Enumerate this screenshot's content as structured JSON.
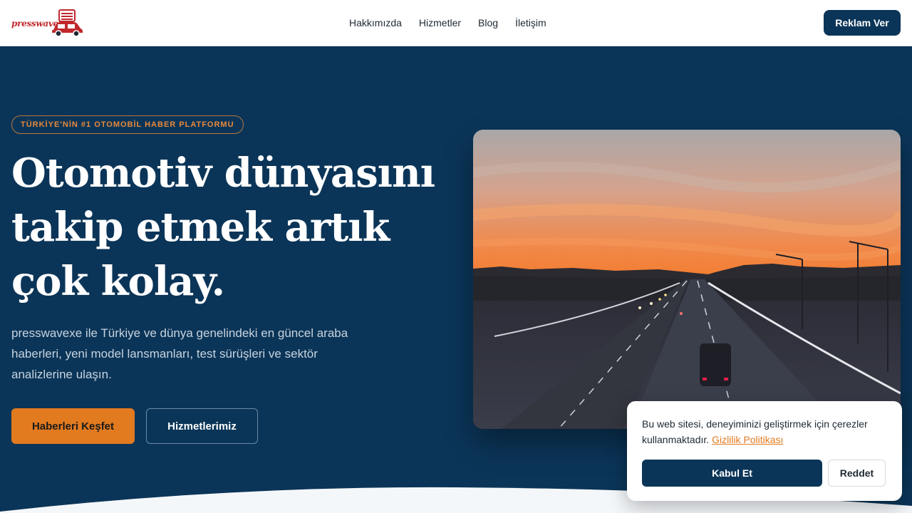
{
  "header": {
    "logo_text": "presswavexe",
    "nav": [
      "Hakkımızda",
      "Hizmetler",
      "Blog",
      "İletişim"
    ],
    "cta_label": "Reklam Ver"
  },
  "hero": {
    "badge": "TÜRKİYE'NİN #1 OTOMOBİL HABER PLATFORMU",
    "headline_line1": "Otomotiv dünyasını",
    "headline_line2": "takip etmek artık",
    "headline_line3": "çok kolay.",
    "subtext": "presswavexe ile Türkiye ve dünya genelindeki en güncel araba haberleri, yeni model lansmanları, test sürüşleri ve sektör analizlerine ulaşın.",
    "primary_button": "Haberleri Keşfet",
    "secondary_button": "Hizmetlerimiz"
  },
  "cookie": {
    "text": "Bu web sitesi, deneyiminizi geliştirmek için çerezler kullanmaktadır.",
    "link": "Gizlilik Politikası",
    "accept": "Kabul Et",
    "reject": "Reddet"
  },
  "colors": {
    "navy": "#0b3558",
    "accent": "#e27a1f",
    "logo_red": "#c0282d"
  }
}
